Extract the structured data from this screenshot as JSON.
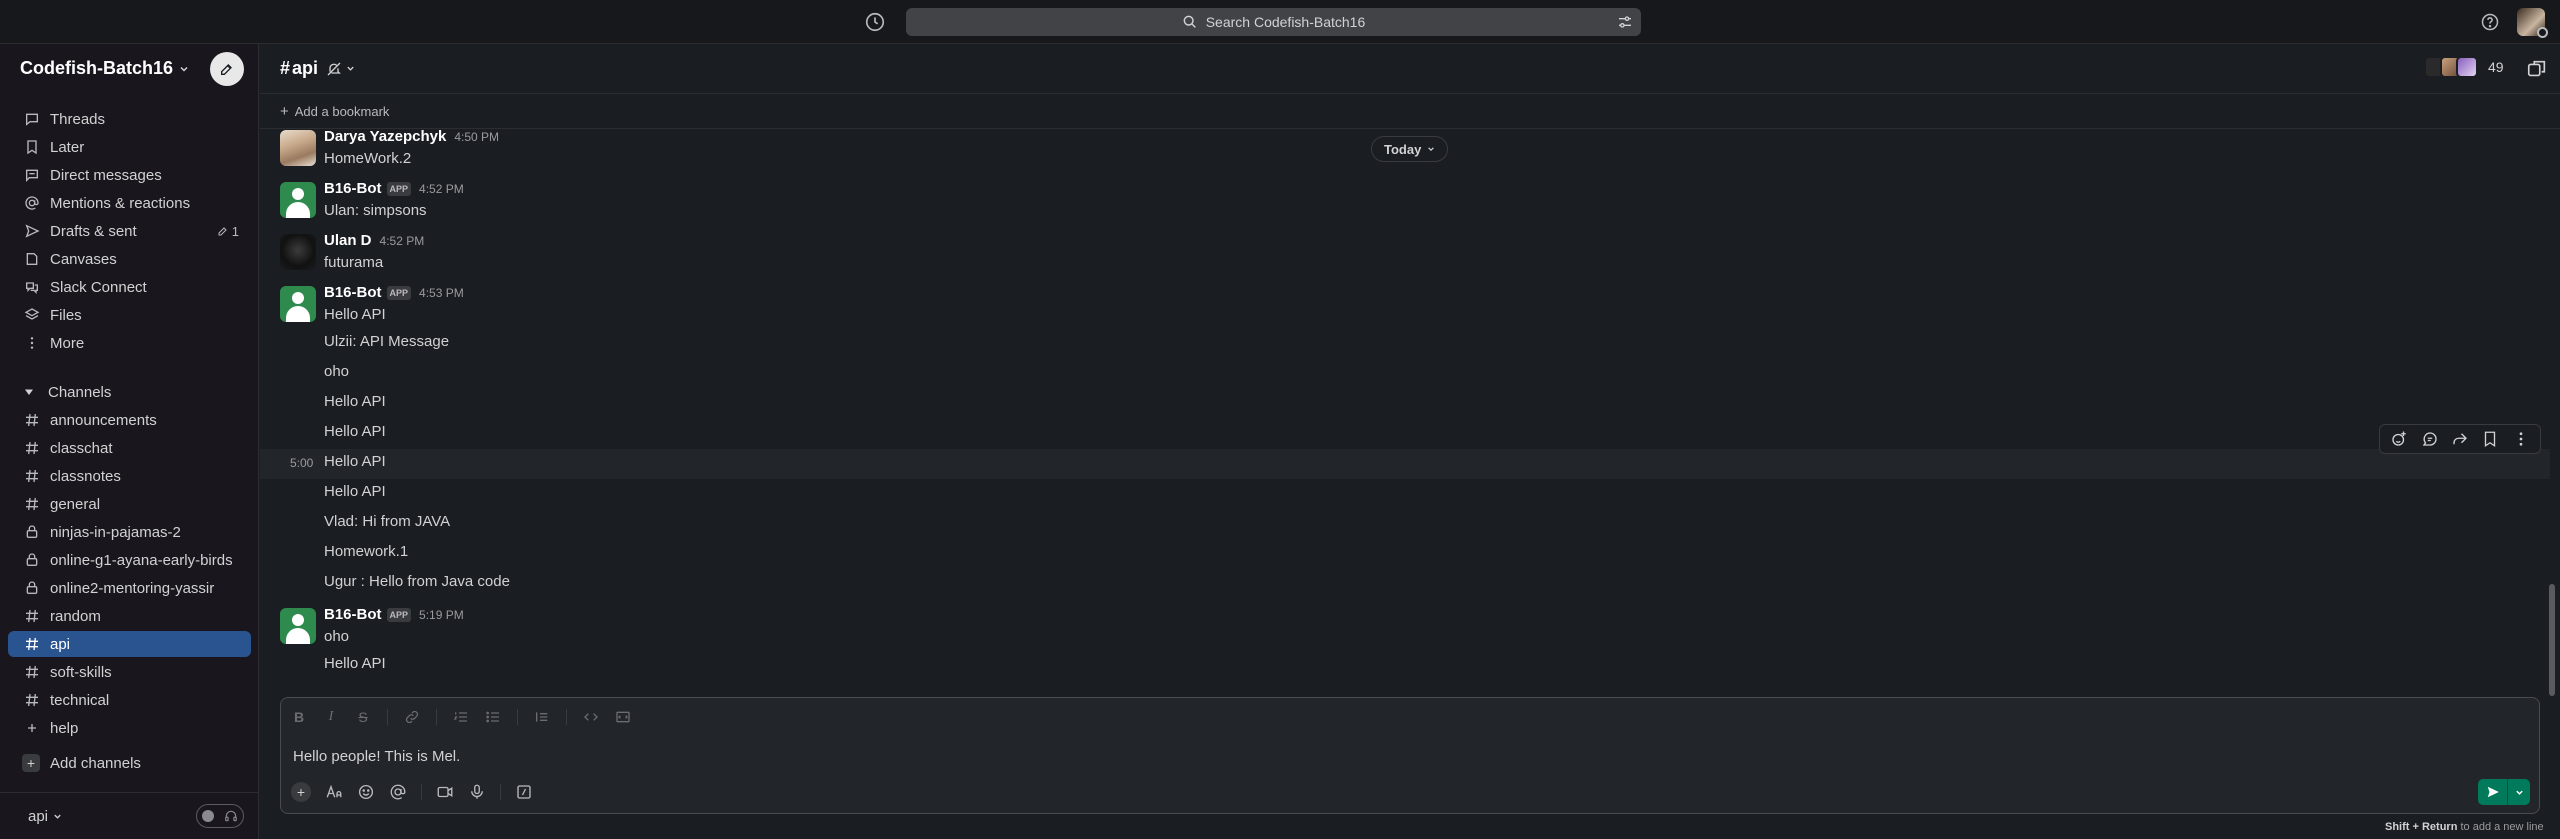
{
  "topbar": {
    "search_placeholder": "Search Codefish-Batch16"
  },
  "sidebar": {
    "workspace_name": "Codefish-Batch16",
    "nav": [
      {
        "label": "Threads",
        "icon": "threads-icon"
      },
      {
        "label": "Later",
        "icon": "bookmark-icon"
      },
      {
        "label": "Direct messages",
        "icon": "dm-icon"
      },
      {
        "label": "Mentions & reactions",
        "icon": "at-icon"
      },
      {
        "label": "Drafts & sent",
        "icon": "send-icon",
        "count": "1"
      },
      {
        "label": "Canvases",
        "icon": "canvas-icon"
      },
      {
        "label": "Slack Connect",
        "icon": "connect-icon"
      },
      {
        "label": "Files",
        "icon": "files-icon"
      },
      {
        "label": "More",
        "icon": "more-icon"
      }
    ],
    "channels_header": "Channels",
    "channels": [
      {
        "name": "announcements",
        "type": "public"
      },
      {
        "name": "classchat",
        "type": "public"
      },
      {
        "name": "classnotes",
        "type": "public"
      },
      {
        "name": "general",
        "type": "public"
      },
      {
        "name": "ninjas-in-pajamas-2",
        "type": "private"
      },
      {
        "name": "online-g1-ayana-early-birds",
        "type": "private"
      },
      {
        "name": "online2-mentoring-yassir",
        "type": "private"
      },
      {
        "name": "random",
        "type": "public"
      },
      {
        "name": "api",
        "type": "public",
        "active": true
      },
      {
        "name": "soft-skills",
        "type": "public"
      },
      {
        "name": "technical",
        "type": "public"
      },
      {
        "name": "help",
        "type": "join"
      }
    ],
    "add_channels": "Add channels",
    "footer_channel": "api"
  },
  "channel": {
    "hash": "#",
    "name": "api",
    "member_count": "49",
    "add_bookmark": "Add a bookmark",
    "today_label": "Today"
  },
  "messages": {
    "m1": {
      "author": "Darya Yazepchyk",
      "time": "4:50 PM",
      "text": "HomeWork.2"
    },
    "m2": {
      "author": "B16-Bot",
      "badge": "APP",
      "time": "4:52 PM",
      "text": "Ulan: simpsons"
    },
    "m3": {
      "author": "Ulan D",
      "time": "4:52 PM",
      "text": "futurama"
    },
    "m4": {
      "author": "B16-Bot",
      "badge": "APP",
      "time": "4:53 PM",
      "text": "Hello API",
      "followups": [
        {
          "text": "Ulzii: API Message"
        },
        {
          "text": "oho"
        },
        {
          "text": "Hello API"
        },
        {
          "text": "Hello API"
        },
        {
          "text": "Hello API",
          "hover_time": "5:00"
        },
        {
          "text": "Hello API"
        },
        {
          "text": "Vlad: Hi from JAVA"
        },
        {
          "text": "Homework.1"
        },
        {
          "text": "Ugur : Hello from Java code"
        }
      ]
    },
    "m5": {
      "author": "B16-Bot",
      "badge": "APP",
      "time": "5:19 PM",
      "text": "oho",
      "followups": [
        {
          "text": "Hello API"
        }
      ]
    }
  },
  "composer": {
    "value": "Hello people! This is Mel.",
    "hint_keys": "Shift + Return",
    "hint_text": " to add a new line"
  },
  "colors": {
    "accent": "#2a5490",
    "send": "#007a5a",
    "bot_avatar": "#2f8a4e",
    "background": "#1a1d21"
  }
}
